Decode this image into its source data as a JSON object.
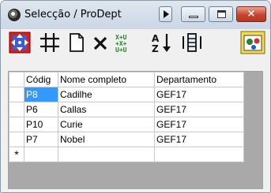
{
  "window": {
    "title": "Selecção / ProDept",
    "controls": {
      "help": "help",
      "minimize": "minimize",
      "maximize": "maximize",
      "close": "×"
    }
  },
  "toolbar": {
    "tools": [
      "move-icon",
      "grid-icon",
      "new-document-icon",
      "delete-icon",
      "sort-columns-icon",
      "sort-az-icon",
      "column-icon",
      "query-icon"
    ]
  },
  "grid": {
    "columns": [
      "Códig",
      "Nome completo",
      "Departamento"
    ],
    "rows": [
      {
        "codigo": "P8",
        "nome": "Cadilhe",
        "departamento": "GEF17",
        "current": true
      },
      {
        "codigo": "P6",
        "nome": "Callas",
        "departamento": "GEF17",
        "current": false
      },
      {
        "codigo": "P10",
        "nome": "Curie",
        "departamento": "GEF17",
        "current": false
      },
      {
        "codigo": "P7",
        "nome": "Nobel",
        "departamento": "GEF17",
        "current": false
      }
    ],
    "new_row_marker": "*"
  },
  "colors": {
    "selection": "#3399ff",
    "close_button": "#c8432d",
    "grid_background": "#a9a9a9"
  }
}
